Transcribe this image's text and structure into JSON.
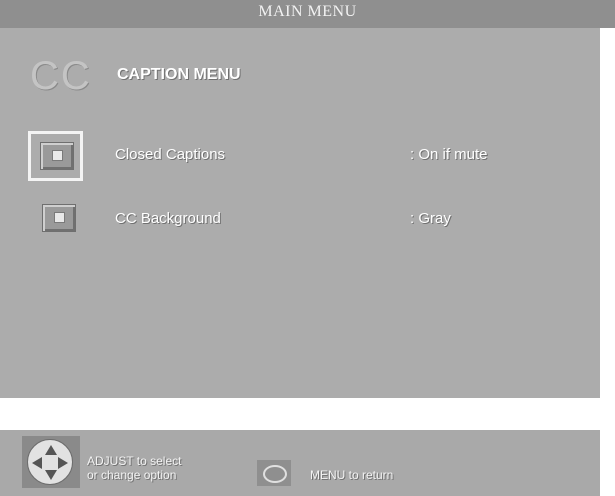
{
  "header": {
    "title": "MAIN MENU"
  },
  "caption_menu": {
    "logo_text": "CC",
    "title": "CAPTION MENU",
    "items": [
      {
        "label": "Closed Captions",
        "value": ": On if mute",
        "selected": true
      },
      {
        "label": "CC Background",
        "value": ": Gray",
        "selected": false
      }
    ]
  },
  "footer": {
    "adjust_line1": "ADJUST to select",
    "adjust_line2": "or change option",
    "menu_hint": "MENU to return"
  },
  "icons": {
    "directional": "dpad-icon",
    "menu": "oval-menu-button-icon",
    "item": "menu-item-icon"
  },
  "colors": {
    "panel": "#acacac",
    "title_bar": "#8f8f8f",
    "text": "#ffffff"
  }
}
